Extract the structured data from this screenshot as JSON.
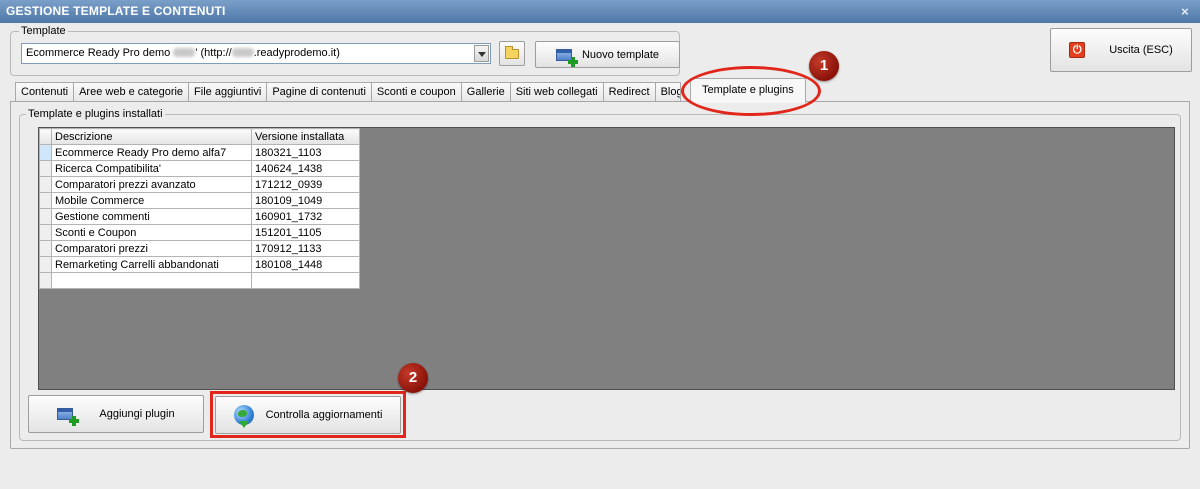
{
  "window": {
    "title": "GESTIONE TEMPLATE E CONTENUTI",
    "close_glyph": "×"
  },
  "template": {
    "legend": "Template",
    "combo_value_prefix": "Ecommerce Ready Pro demo ",
    "combo_value_suffix": "' (http://",
    "combo_value_domain": ".readyprodemo.it)",
    "new_template_label": "Nuovo template"
  },
  "exit": {
    "label": "Uscita (ESC)"
  },
  "tabs": [
    {
      "label": "Contenuti"
    },
    {
      "label": "Aree web e categorie"
    },
    {
      "label": "File aggiuntivi"
    },
    {
      "label": "Pagine di contenuti"
    },
    {
      "label": "Sconti e coupon"
    },
    {
      "label": "Gallerie"
    },
    {
      "label": "Siti web collegati"
    },
    {
      "label": "Redirect"
    },
    {
      "label": "Blog"
    }
  ],
  "active_tab": {
    "label": "Template e plugins"
  },
  "plugins": {
    "legend": "Template e plugins installati",
    "columns": {
      "description": "Descrizione",
      "version": "Versione installata"
    },
    "rows": [
      {
        "description": "Ecommerce Ready Pro demo alfa7",
        "version": "180321_1103"
      },
      {
        "description": "Ricerca Compatibilita'",
        "version": "140624_1438"
      },
      {
        "description": "Comparatori prezzi avanzato",
        "version": "171212_0939"
      },
      {
        "description": "Mobile Commerce",
        "version": "180109_1049"
      },
      {
        "description": "Gestione commenti",
        "version": "160901_1732"
      },
      {
        "description": "Sconti e Coupon",
        "version": "151201_1105"
      },
      {
        "description": "Comparatori prezzi",
        "version": "170912_1133"
      },
      {
        "description": "Remarketing Carrelli abbandonati",
        "version": "180108_1448"
      }
    ],
    "add_label": "Aggiungi plugin",
    "check_label": "Controlla aggiornamenti"
  },
  "annotations": {
    "badge1": "1",
    "badge2": "2",
    "highlight_color": "#e1261b"
  }
}
